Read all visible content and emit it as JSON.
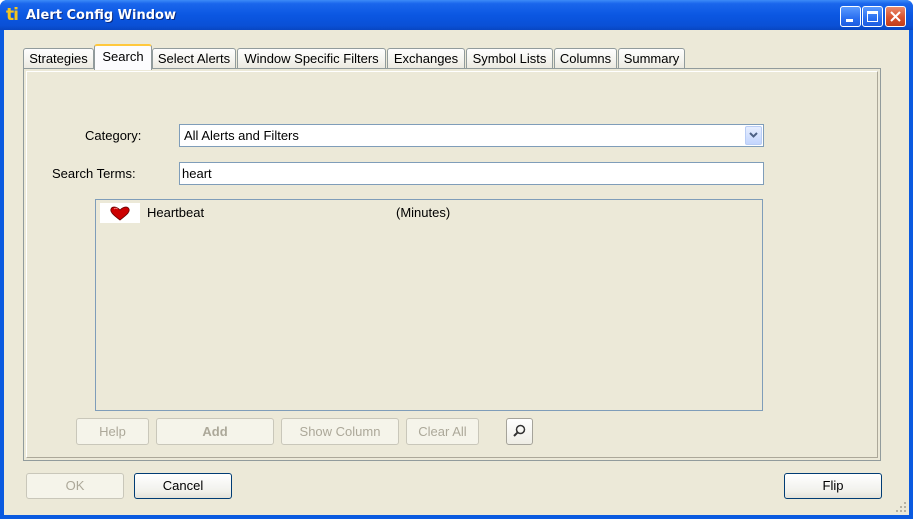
{
  "window": {
    "title": "Alert Config Window",
    "app_icon_text": "ti"
  },
  "tabs": [
    {
      "label": "Strategies",
      "active": false
    },
    {
      "label": "Search",
      "active": true
    },
    {
      "label": "Select Alerts",
      "active": false
    },
    {
      "label": "Window Specific Filters",
      "active": false
    },
    {
      "label": "Exchanges",
      "active": false
    },
    {
      "label": "Symbol Lists",
      "active": false
    },
    {
      "label": "Columns",
      "active": false
    },
    {
      "label": "Summary",
      "active": false
    }
  ],
  "search": {
    "category_label": "Category:",
    "category_value": "All Alerts and Filters",
    "terms_label": "Search Terms:",
    "terms_value": "heart"
  },
  "results": [
    {
      "icon": "heart-icon",
      "name": "Heartbeat",
      "unit": "(Minutes)"
    }
  ],
  "actions": {
    "help": "Help",
    "add": "Add",
    "show_column": "Show Column",
    "clear_all": "Clear All"
  },
  "footer": {
    "ok": "OK",
    "cancel": "Cancel",
    "flip": "Flip"
  },
  "colors": {
    "titlebar": "#0a5ae0",
    "dialog_bg": "#ece9d8",
    "active_tab_accent": "#ffc83c",
    "heart": "#cc0000"
  }
}
